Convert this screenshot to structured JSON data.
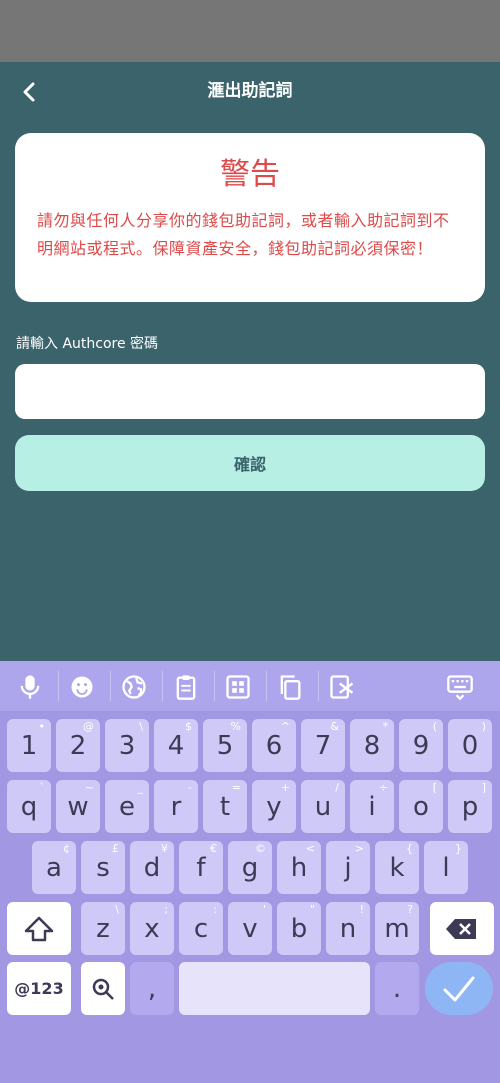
{
  "header": {
    "title": "滙出助記詞",
    "back_icon": "chevron-left-icon"
  },
  "warning": {
    "title": "警告",
    "body": "請勿與任何人分享你的錢包助記詞，或者輸入助記詞到不明網站或程式。保障資產安全，錢包助記詞必須保密！",
    "color": "#dc4a4a"
  },
  "password": {
    "label": "請輸入 Authcore 密碼",
    "value": "",
    "placeholder": ""
  },
  "confirm": {
    "label": "確認"
  },
  "keyboard": {
    "toolbar": [
      "microphone-icon",
      "emoji-icon",
      "globe-icon",
      "clipboard-icon",
      "grid-icon",
      "copy-icon",
      "cut-icon",
      "keyboard-hide-icon"
    ],
    "row_numbers": [
      {
        "k": "1",
        "h": "•"
      },
      {
        "k": "2",
        "h": "@"
      },
      {
        "k": "3",
        "h": "\\"
      },
      {
        "k": "4",
        "h": "$"
      },
      {
        "k": "5",
        "h": "%"
      },
      {
        "k": "6",
        "h": "^"
      },
      {
        "k": "7",
        "h": "&"
      },
      {
        "k": "8",
        "h": "*"
      },
      {
        "k": "9",
        "h": "("
      },
      {
        "k": "0",
        "h": ")"
      }
    ],
    "row_q": [
      {
        "k": "q",
        "h": "`"
      },
      {
        "k": "w",
        "h": "~"
      },
      {
        "k": "e",
        "h": "_"
      },
      {
        "k": "r",
        "h": "-"
      },
      {
        "k": "t",
        "h": "="
      },
      {
        "k": "y",
        "h": "+"
      },
      {
        "k": "u",
        "h": "/"
      },
      {
        "k": "i",
        "h": "÷"
      },
      {
        "k": "o",
        "h": "["
      },
      {
        "k": "p",
        "h": "]"
      }
    ],
    "row_a": [
      {
        "k": "a",
        "h": "¢"
      },
      {
        "k": "s",
        "h": "£"
      },
      {
        "k": "d",
        "h": "¥"
      },
      {
        "k": "f",
        "h": "€"
      },
      {
        "k": "g",
        "h": "©"
      },
      {
        "k": "h",
        "h": "<"
      },
      {
        "k": "j",
        "h": ">"
      },
      {
        "k": "k",
        "h": "{"
      },
      {
        "k": "l",
        "h": "}"
      }
    ],
    "row_z": [
      {
        "k": "z",
        "h": "\\"
      },
      {
        "k": "x",
        "h": ";"
      },
      {
        "k": "c",
        "h": ":"
      },
      {
        "k": "v",
        "h": "'"
      },
      {
        "k": "b",
        "h": "\""
      },
      {
        "k": "n",
        "h": "!"
      },
      {
        "k": "m",
        "h": "?"
      }
    ],
    "symbols_label": "@123",
    "comma": ",",
    "period": "."
  }
}
